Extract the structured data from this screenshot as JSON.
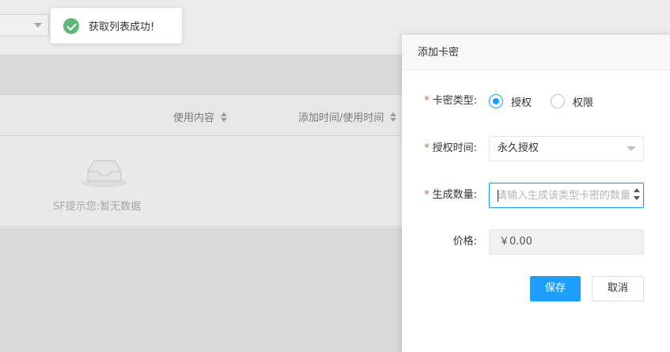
{
  "toast": {
    "message": "获取列表成功!"
  },
  "table": {
    "columns": [
      {
        "label": "使用内容"
      },
      {
        "label": "添加时间/使用时间"
      }
    ],
    "empty_text": "SF提示您:暂无数据"
  },
  "dialog": {
    "title": "添加卡密",
    "fields": {
      "card_type": {
        "label": "卡密类型:",
        "options": [
          {
            "label": "授权",
            "selected": true
          },
          {
            "label": "权限",
            "selected": false
          }
        ]
      },
      "auth_time": {
        "label": "授权时间:",
        "value": "永久授权"
      },
      "quantity": {
        "label": "生成数量:",
        "placeholder": "请输入生成该类型卡密的数量",
        "value": ""
      },
      "price": {
        "label": "价格:",
        "value": "￥0.00"
      }
    },
    "buttons": {
      "save": "保存",
      "cancel": "取消"
    }
  },
  "colors": {
    "primary": "#1e9fff",
    "success": "#5fb878",
    "required": "#ff5722"
  },
  "icons": {
    "toast": "check-circle-icon",
    "empty": "empty-inbox-icon"
  }
}
